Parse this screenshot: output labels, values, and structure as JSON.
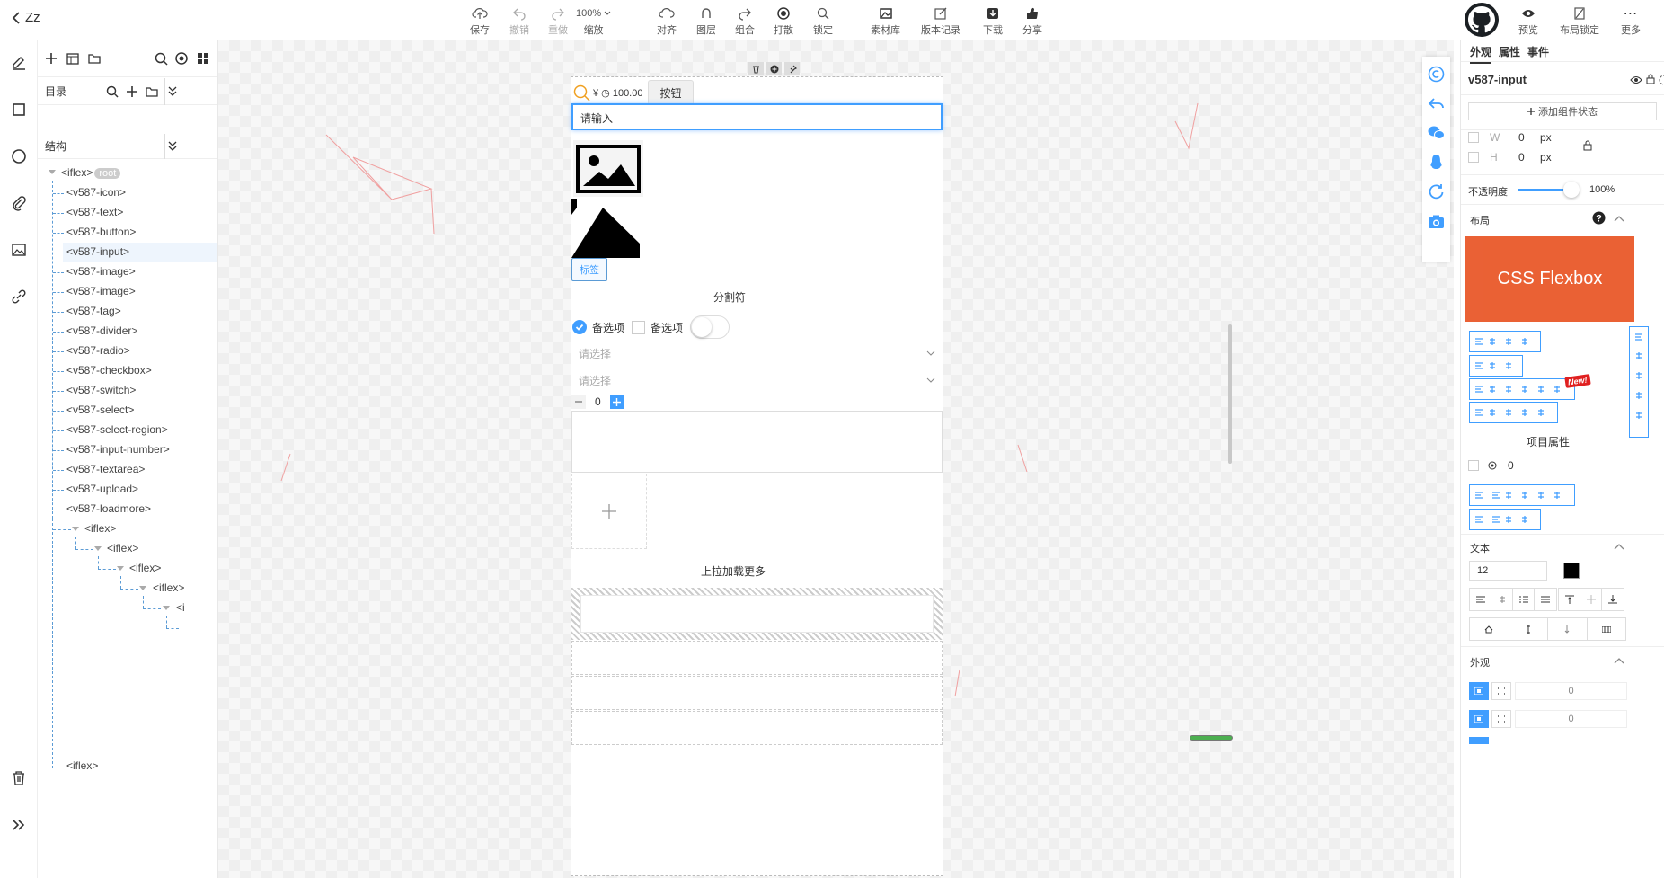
{
  "app": {
    "project_name": "Zz"
  },
  "toolbar": {
    "items": [
      {
        "label": "保存"
      },
      {
        "label": "撤销"
      },
      {
        "label": "重做"
      },
      {
        "label": "缩放",
        "value": "100%"
      },
      {
        "label": "对齐"
      },
      {
        "label": "图层"
      },
      {
        "label": "组合"
      },
      {
        "label": "打散"
      },
      {
        "label": "锁定"
      },
      {
        "label": "素材库"
      },
      {
        "label": "版本记录"
      },
      {
        "label": "下载"
      },
      {
        "label": "分享"
      },
      {
        "label": "预览"
      },
      {
        "label": "布局锁定"
      },
      {
        "label": "更多"
      }
    ]
  },
  "tree": {
    "catalog_label": "目录",
    "structure_label": "结构",
    "root_tag": "<iflex>",
    "root_badge": "root",
    "nodes": [
      "<v587-icon>",
      "<v587-text>",
      "<v587-button>",
      "<v587-input>",
      "<v587-image>",
      "<v587-image>",
      "<v587-tag>",
      "<v587-divider>",
      "<v587-radio>",
      "<v587-checkbox>",
      "<v587-switch>",
      "<v587-select>",
      "<v587-select-region>",
      "<v587-input-number>",
      "<v587-textarea>",
      "<v587-upload>",
      "<v587-loadmore>"
    ],
    "nested": [
      "<iflex>",
      "<iflex>",
      "<iflex>",
      "<iflex>",
      "<i"
    ],
    "bottom_node": "<iflex>"
  },
  "phone": {
    "price_text": "¥ ◷ 100.00",
    "button_label": "按钮",
    "input_placeholder": "请输入",
    "tag_label": "标签",
    "divider_text": "分割符",
    "checkbox_label_1": "备选项",
    "checkbox_label_2": "备选项",
    "select_placeholder_1": "请选择",
    "select_placeholder_2": "请选择",
    "number_value": "0",
    "loadmore_text": "上拉加载更多"
  },
  "panel": {
    "tabs": [
      "外观",
      "属性",
      "事件"
    ],
    "component_name": "v587-input",
    "add_state_label": "添加组件状态",
    "w_label": "W",
    "w_value": "0",
    "w_unit": "px",
    "h_label": "H",
    "h_value": "0",
    "h_unit": "px",
    "opacity_label": "不透明度",
    "opacity_value": "100%",
    "layout_label": "布局",
    "banner_text": "CSS Flexbox",
    "new_badge": "New!",
    "item_props_label": "项目属性",
    "order_value": "0",
    "text_label": "文本",
    "font_size": "12",
    "appearance_label": "外观",
    "appearance_value_1": "0",
    "appearance_value_2": "0"
  },
  "colors": {
    "accent": "#409eff",
    "banner": "#e8501f",
    "badge_red": "#e02020"
  }
}
